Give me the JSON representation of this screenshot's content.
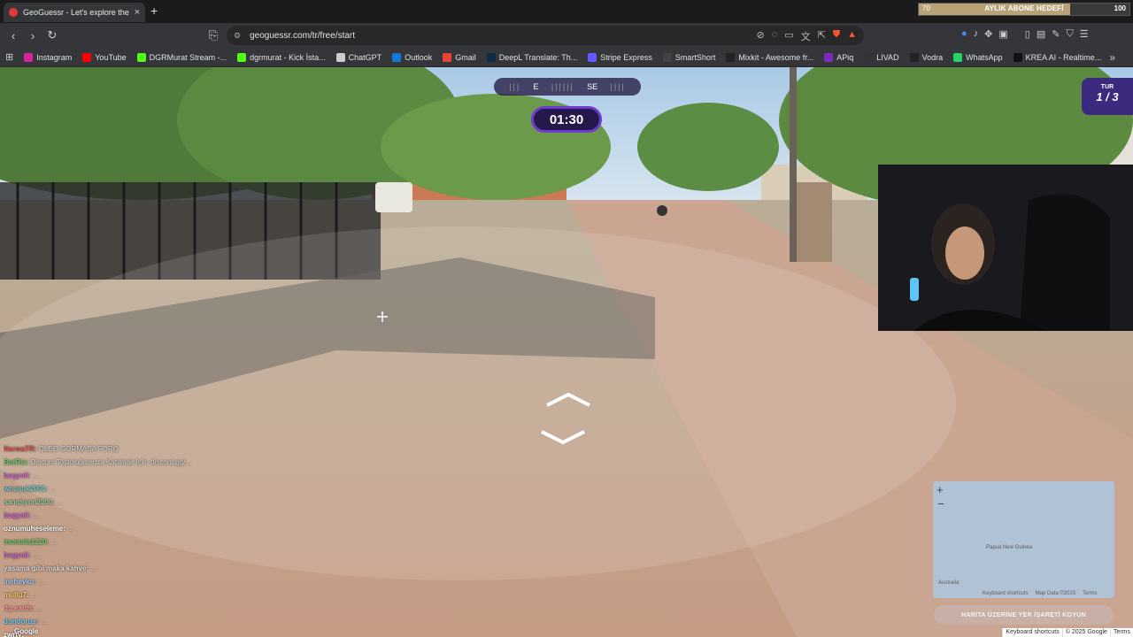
{
  "tab": {
    "title": "GeoGuessr - Let's explore the",
    "close": "×"
  },
  "new_tab_glyph": "+",
  "goal_bar": {
    "min": "70",
    "label": "AYLIK ABONE HEDEFİ",
    "max": "100",
    "progress": 0.72,
    "accent": "#b8a378"
  },
  "toolbar": {
    "back": "‹",
    "forward": "›",
    "reload": "↻",
    "bookmark_glyph": "⎘",
    "url": "geoguessr.com/tr/free/start"
  },
  "bookmarks": [
    {
      "label": "Instagram",
      "color": "#d6249f"
    },
    {
      "label": "YouTube",
      "color": "#ff0000"
    },
    {
      "label": "DGRMurat Stream -...",
      "color": "#53fc18"
    },
    {
      "label": "dgrmurat - Kick İsta...",
      "color": "#53fc18"
    },
    {
      "label": "ChatGPT",
      "color": "#cccccc"
    },
    {
      "label": "Outlook",
      "color": "#0f78d4"
    },
    {
      "label": "Gmail",
      "color": "#ea4335"
    },
    {
      "label": "DeepL Translate: Th...",
      "color": "#0f2b46"
    },
    {
      "label": "Stripe Express",
      "color": "#635bff"
    },
    {
      "label": "SmartShort",
      "color": "#444444"
    },
    {
      "label": "Mixkit - Awesome fr...",
      "color": "#222222"
    },
    {
      "label": "APiq",
      "color": "#7b2cbf"
    },
    {
      "label": "LIVAD",
      "color": "#333333"
    },
    {
      "label": "Vodra",
      "color": "#222222"
    },
    {
      "label": "WhatsApp",
      "color": "#25d366"
    },
    {
      "label": "KREA AI - Realtime...",
      "color": "#111111"
    }
  ],
  "game": {
    "compass": {
      "left": "E",
      "right": "SE"
    },
    "timer": "01:30",
    "round_label": "TUR",
    "round_value": "1 / 3",
    "guess_button": "HARİTA ÜZERİNE YER İŞARETİ KOYUN",
    "map_land_1": "Papua New Guinea",
    "map_land_2": "Australia",
    "map_shortcuts": "Keyboard shortcuts",
    "map_data": "Map Data ©2025",
    "map_terms": "Terms",
    "google_logo": "Google",
    "footer": [
      "Keyboard shortcuts",
      "© 2025 Google",
      "Terms"
    ]
  },
  "chat": [
    {
      "user": "NarwaTR:",
      "text": "OLEO GORMASA FORO",
      "color": "#d55"
    },
    {
      "user": "BotRix:",
      "text": "Discord Topluluğumuza Katılmak İçin: discord.gg/...",
      "color": "#6c6"
    },
    {
      "user": "bugyali:",
      "text": "...",
      "color": "#c6c"
    },
    {
      "user": "wnusuk2001:",
      "text": "...",
      "color": "#6cc"
    },
    {
      "user": "sampiyon2000:",
      "text": "...",
      "color": "#9c9"
    },
    {
      "user": "bugyali:",
      "text": "...",
      "color": "#c6c"
    },
    {
      "user": "oznumuheseleme:",
      "text": "...",
      "color": "#fff"
    },
    {
      "user": "mustafa1210:",
      "text": "...",
      "color": "#6c6"
    },
    {
      "user": "bugyali:",
      "text": "...",
      "color": "#c6c"
    },
    {
      "user": "yasama gibi maka kahve:",
      "text": "...",
      "color": "#ddd"
    },
    {
      "user": "inebeyko:",
      "text": "...",
      "color": "#9cf"
    },
    {
      "user": "mullu7:",
      "text": "...",
      "color": "#fc6"
    },
    {
      "user": "dg.earth:",
      "text": "...",
      "color": "#f99"
    },
    {
      "user": "dondorus:",
      "text": "...",
      "color": "#6cf"
    },
    {
      "user": "zwrty:",
      "text": "...",
      "color": "#fff"
    }
  ]
}
